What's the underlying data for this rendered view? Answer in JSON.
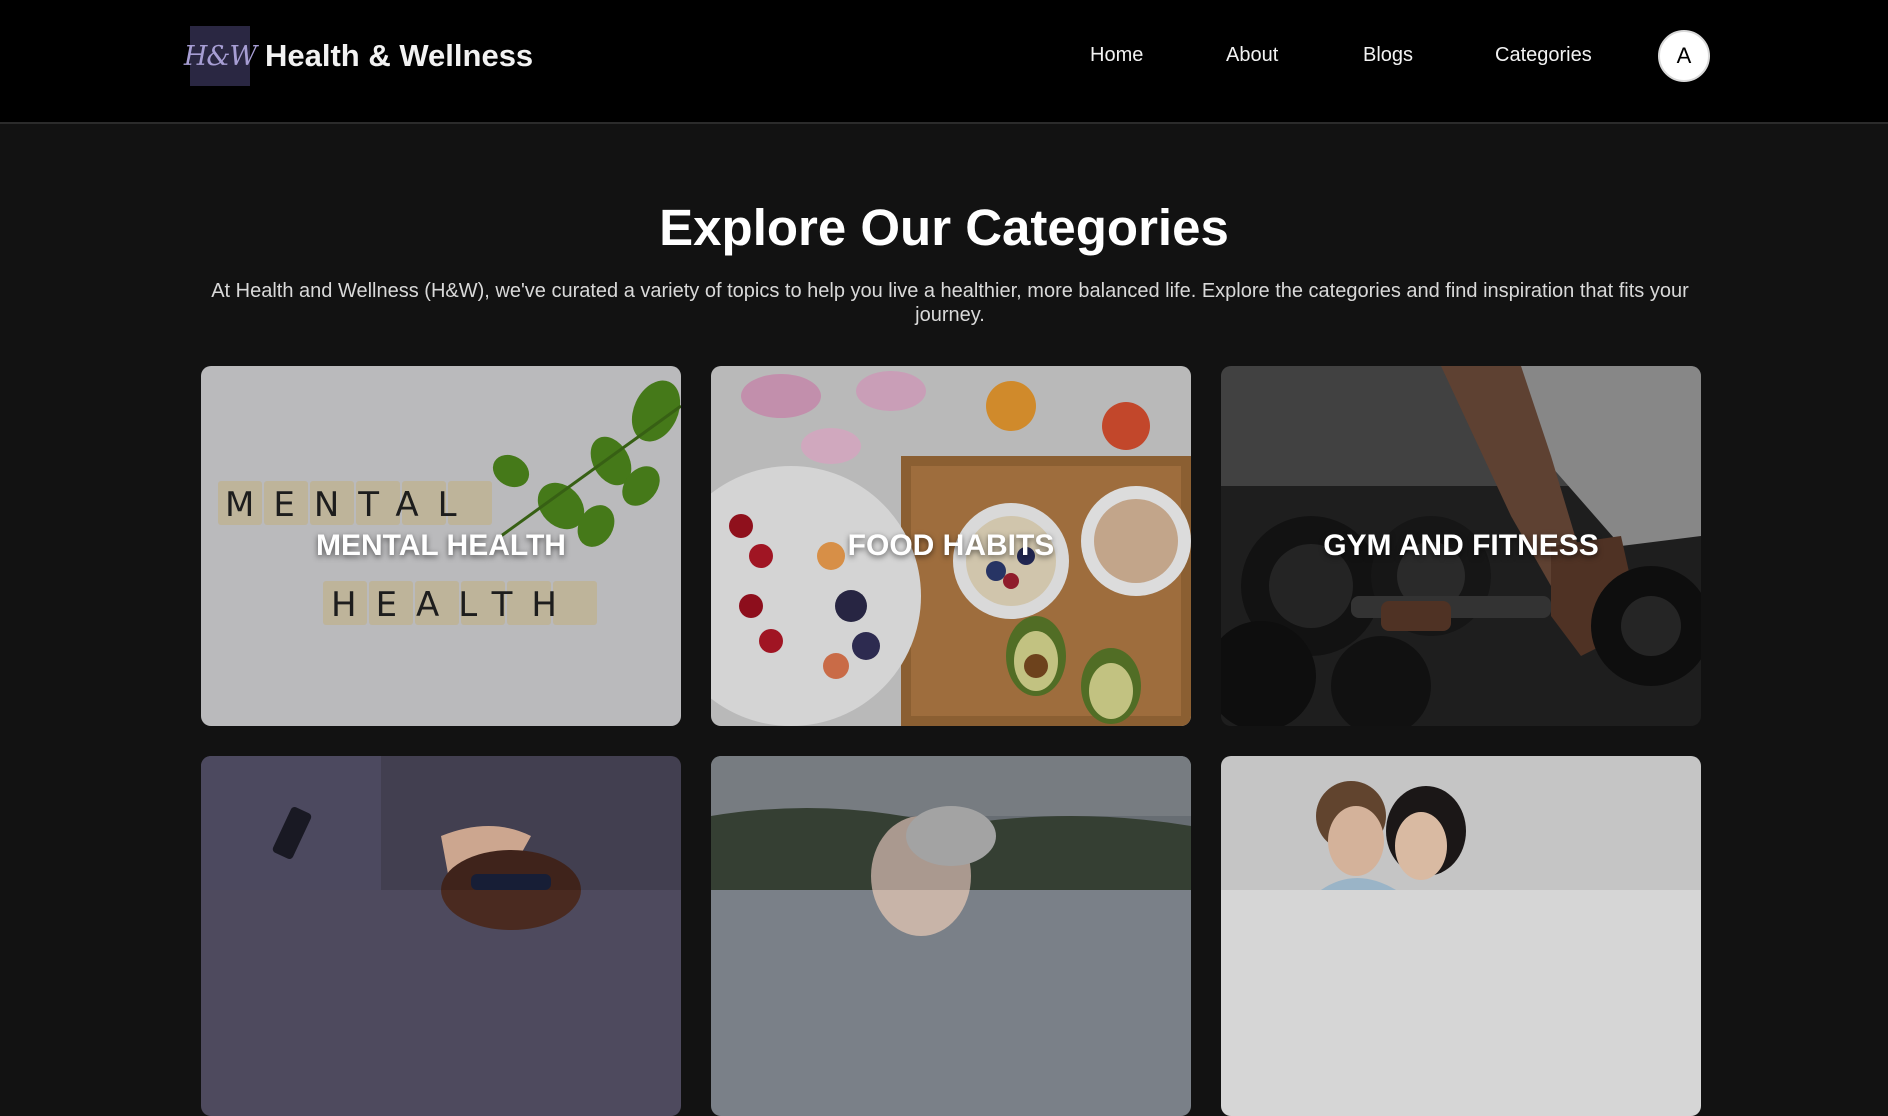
{
  "header": {
    "logo_text": "H&W",
    "brand": "Health & Wellness",
    "nav": [
      "Home",
      "About",
      "Blogs",
      "Categories"
    ],
    "avatar_initial": "A"
  },
  "main": {
    "title": "Explore Our Categories",
    "intro": "At Health and Wellness (H&W), we've curated a variety of topics to help you live a healthier, more balanced life. Explore the categories and find inspiration that fits your journey.",
    "categories": [
      {
        "label": "MENTAL HEALTH",
        "image_text_line1": "MENTAL",
        "image_text_line2": "HEALTH"
      },
      {
        "label": "FOOD HABITS"
      },
      {
        "label": "GYM AND FITNESS"
      },
      {
        "label": ""
      },
      {
        "label": ""
      },
      {
        "label": ""
      }
    ]
  },
  "colors": {
    "header_bg": "#000000",
    "page_bg": "#121212",
    "logo_bg": "#2a2742",
    "logo_text": "#a79ed4"
  }
}
